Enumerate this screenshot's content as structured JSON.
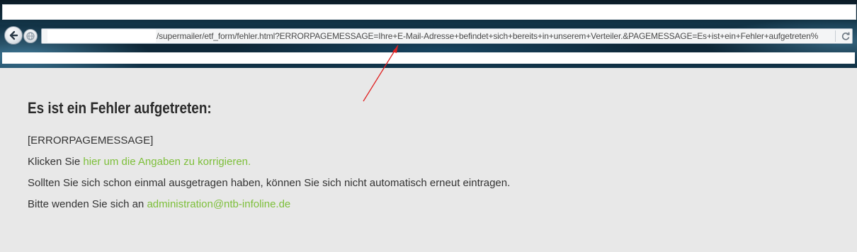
{
  "browser": {
    "url_path": "/supermailer/etf_form/fehler.html?ERRORPAGEMESSAGE=Ihre+E-Mail-Adresse+befindet+sich+bereits+in+unserem+Verteiler.&PAGEMESSAGE=Es+ist+ein+Fehler+aufgetreten%"
  },
  "page": {
    "heading": "Es ist ein Fehler aufgetreten:",
    "error_placeholder": "[ERRORPAGEMESSAGE]",
    "line2_prefix": "Klicken Sie ",
    "line2_link": "hier um die Angaben zu korrigieren.",
    "line3": "Sollten Sie sich schon einmal ausgetragen haben, können Sie sich nicht automatisch erneut eintragen.",
    "line4_prefix": "Bitte wenden Sie sich an ",
    "line4_link": "administration@ntb-infoline.de"
  },
  "colors": {
    "link": "#7dbf3a",
    "annotation_arrow": "#e02020",
    "page_background": "#e8e8e8"
  }
}
